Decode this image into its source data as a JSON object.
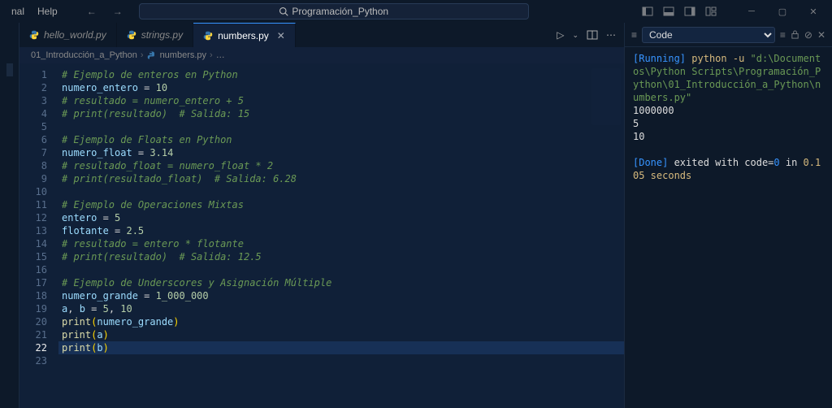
{
  "titlebar": {
    "menu": [
      "nal",
      "Help"
    ],
    "search_text": "Programación_Python"
  },
  "tabs": [
    {
      "label": "hello_world.py",
      "active": false,
      "close": false
    },
    {
      "label": "strings.py",
      "active": false,
      "close": false
    },
    {
      "label": "numbers.py",
      "active": true,
      "close": true
    }
  ],
  "breadcrumb": {
    "folder": "01_Introducción_a_Python",
    "file": "numbers.py",
    "more": "…"
  },
  "editor": {
    "line_count": 23,
    "selected_line": 22,
    "lines": [
      {
        "n": 1,
        "tokens": [
          [
            "cm",
            "# Ejemplo de enteros en Python"
          ]
        ]
      },
      {
        "n": 2,
        "tokens": [
          [
            "id",
            "numero_entero"
          ],
          [
            "op",
            " = "
          ],
          [
            "num",
            "10"
          ]
        ]
      },
      {
        "n": 3,
        "tokens": [
          [
            "cm",
            "# resultado = numero_entero + 5"
          ]
        ]
      },
      {
        "n": 4,
        "tokens": [
          [
            "cm",
            "# print(resultado)  # Salida: 15"
          ]
        ]
      },
      {
        "n": 5,
        "tokens": []
      },
      {
        "n": 6,
        "tokens": [
          [
            "cm",
            "# Ejemplo de Floats en Python"
          ]
        ]
      },
      {
        "n": 7,
        "tokens": [
          [
            "id",
            "numero_float"
          ],
          [
            "op",
            " = "
          ],
          [
            "num",
            "3.14"
          ]
        ]
      },
      {
        "n": 8,
        "tokens": [
          [
            "cm",
            "# resultado_float = numero_float * 2"
          ]
        ]
      },
      {
        "n": 9,
        "tokens": [
          [
            "cm",
            "# print(resultado_float)  # Salida: 6.28"
          ]
        ]
      },
      {
        "n": 10,
        "tokens": []
      },
      {
        "n": 11,
        "tokens": [
          [
            "cm",
            "# Ejemplo de Operaciones Mixtas"
          ]
        ]
      },
      {
        "n": 12,
        "tokens": [
          [
            "id",
            "entero"
          ],
          [
            "op",
            " = "
          ],
          [
            "num",
            "5"
          ]
        ]
      },
      {
        "n": 13,
        "tokens": [
          [
            "id",
            "flotante"
          ],
          [
            "op",
            " = "
          ],
          [
            "num",
            "2.5"
          ]
        ]
      },
      {
        "n": 14,
        "tokens": [
          [
            "cm",
            "# resultado = entero * flotante"
          ]
        ]
      },
      {
        "n": 15,
        "tokens": [
          [
            "cm",
            "# print(resultado)  # Salida: 12.5"
          ]
        ]
      },
      {
        "n": 16,
        "tokens": []
      },
      {
        "n": 17,
        "tokens": [
          [
            "cm",
            "# Ejemplo de Underscores y Asignación Múltiple"
          ]
        ]
      },
      {
        "n": 18,
        "tokens": [
          [
            "id",
            "numero_grande"
          ],
          [
            "op",
            " = "
          ],
          [
            "num",
            "1_000_000"
          ]
        ]
      },
      {
        "n": 19,
        "tokens": [
          [
            "id",
            "a"
          ],
          [
            "op",
            ", "
          ],
          [
            "id",
            "b"
          ],
          [
            "op",
            " = "
          ],
          [
            "num",
            "5"
          ],
          [
            "op",
            ", "
          ],
          [
            "num",
            "10"
          ]
        ]
      },
      {
        "n": 20,
        "tokens": [
          [
            "fn",
            "print"
          ],
          [
            "pn",
            "("
          ],
          [
            "id",
            "numero_grande"
          ],
          [
            "pn",
            ")"
          ]
        ]
      },
      {
        "n": 21,
        "tokens": [
          [
            "fn",
            "print"
          ],
          [
            "pn",
            "("
          ],
          [
            "id",
            "a"
          ],
          [
            "pn",
            ")"
          ]
        ]
      },
      {
        "n": 22,
        "tokens": [
          [
            "fn",
            "print"
          ],
          [
            "pn",
            "("
          ],
          [
            "id",
            "b"
          ],
          [
            "pn",
            ")"
          ]
        ]
      },
      {
        "n": 23,
        "tokens": []
      }
    ]
  },
  "panel": {
    "selector": "Code",
    "running_label": "[Running]",
    "command": "python -u",
    "path": "\"d:\\Documentos\\Python Scripts\\Programación_Python\\01_Introducción_a_Python\\numbers.py\"",
    "stdout": [
      "1000000",
      "5",
      "10"
    ],
    "done_label": "[Done]",
    "done_msg_1": " exited with ",
    "done_code_label": "code=",
    "done_code": "0",
    "done_msg_2": " in ",
    "done_time": "0.105",
    "done_msg_3": " seconds"
  }
}
